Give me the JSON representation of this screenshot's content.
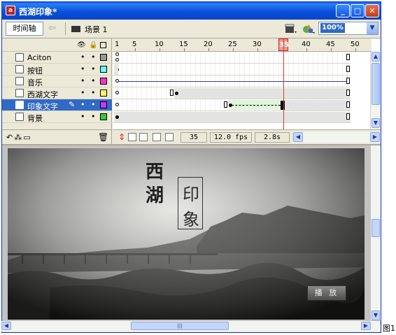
{
  "window": {
    "title": "西湖印象*"
  },
  "toolbar": {
    "timeline_button": "时间轴",
    "scene_label": "场景 1",
    "zoom": "100%"
  },
  "layers": [
    {
      "name": "Aciton",
      "color": "#999999",
      "selected": false
    },
    {
      "name": "按钮",
      "color": "#66ffff",
      "selected": false
    },
    {
      "name": "音乐",
      "color": "#ff33cc",
      "selected": false
    },
    {
      "name": "西湖文字",
      "color": "#ffff66",
      "selected": false
    },
    {
      "name": "印象文字",
      "color": "#cc33ff",
      "selected": true
    },
    {
      "name": "背景",
      "color": "#33cc33",
      "selected": false
    }
  ],
  "ruler": {
    "ticks": [
      "1",
      "5",
      "10",
      "15",
      "20",
      "25",
      "30",
      "35",
      "40",
      "45",
      "50"
    ],
    "current": "35"
  },
  "status": {
    "current_frame": "35",
    "fps": "12.0 fps",
    "elapsed": "2.8s"
  },
  "stage": {
    "text_xi": "西",
    "text_hu": "湖",
    "text_yin": "印",
    "text_xiang": "象",
    "play_button": "播 放"
  },
  "caption": "图1"
}
